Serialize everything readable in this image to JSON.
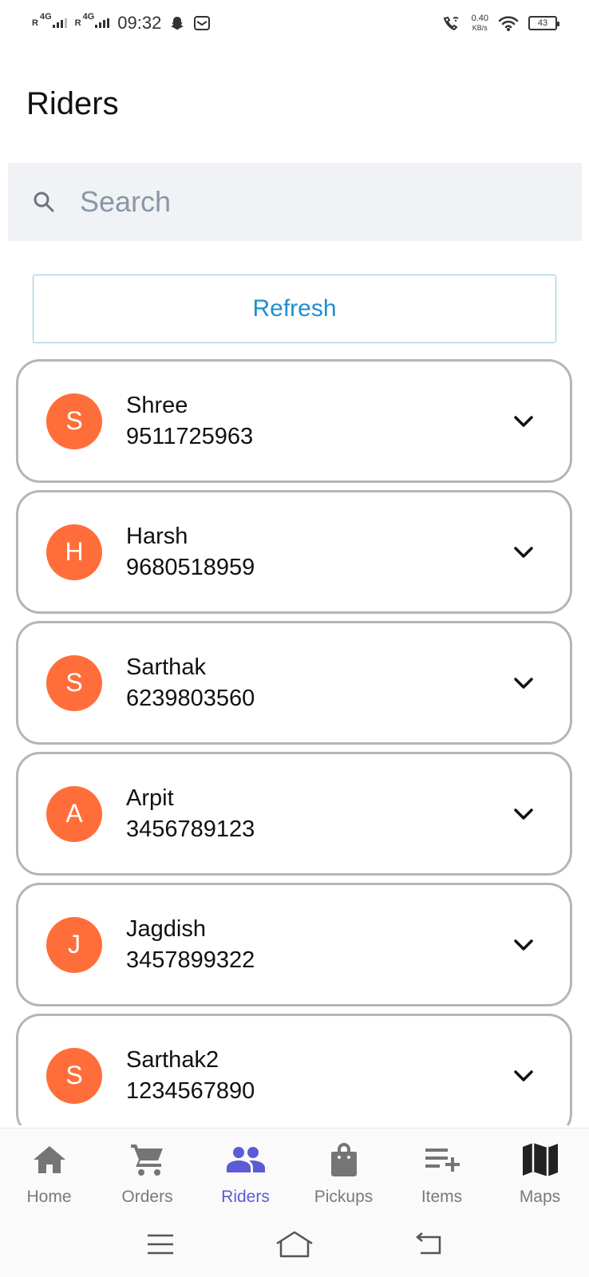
{
  "status_bar": {
    "network1": "4G",
    "network2": "4G",
    "roaming1": "R",
    "roaming2": "R",
    "time": "09:32",
    "speed_value": "0.40",
    "speed_unit": "KB/s",
    "battery": "43"
  },
  "page": {
    "title": "Riders"
  },
  "search": {
    "placeholder": "Search",
    "value": ""
  },
  "refresh": {
    "label": "Refresh"
  },
  "colors": {
    "accent": "#1f8fcf",
    "avatar": "#ff6e3a",
    "nav_active": "#5b5bd6"
  },
  "riders": [
    {
      "initial": "S",
      "name": "Shree",
      "phone": "9511725963"
    },
    {
      "initial": "H",
      "name": "Harsh",
      "phone": "9680518959"
    },
    {
      "initial": "S",
      "name": "Sarthak",
      "phone": "6239803560"
    },
    {
      "initial": "A",
      "name": "Arpit",
      "phone": "3456789123"
    },
    {
      "initial": "J",
      "name": "Jagdish",
      "phone": "3457899322"
    },
    {
      "initial": "S",
      "name": "Sarthak2",
      "phone": "1234567890"
    }
  ],
  "nav": {
    "items": [
      {
        "label": "Home",
        "icon": "home-icon"
      },
      {
        "label": "Orders",
        "icon": "cart-icon"
      },
      {
        "label": "Riders",
        "icon": "people-icon",
        "active": true
      },
      {
        "label": "Pickups",
        "icon": "bag-icon"
      },
      {
        "label": "Items",
        "icon": "playlist-add-icon"
      },
      {
        "label": "Maps",
        "icon": "map-icon"
      }
    ]
  }
}
